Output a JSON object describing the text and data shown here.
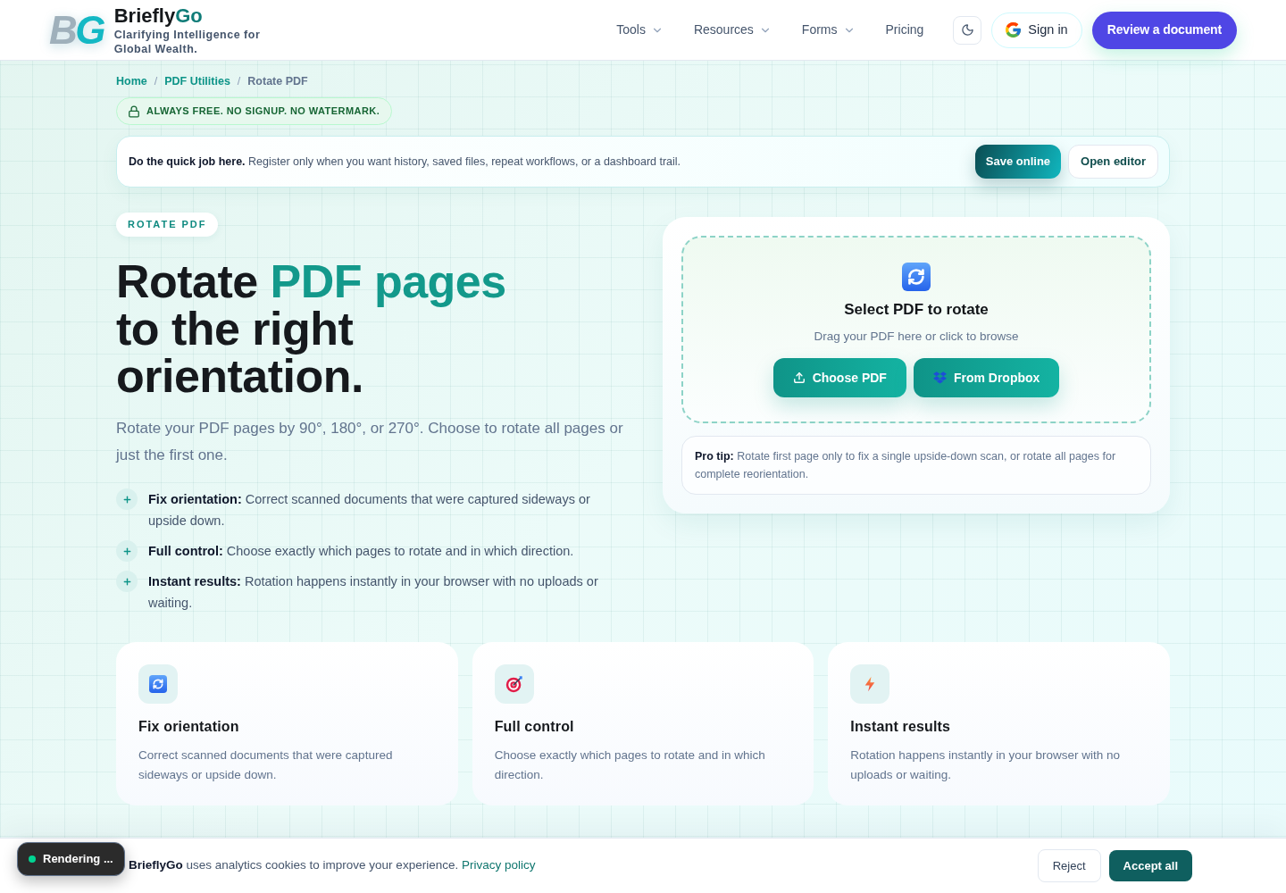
{
  "header": {
    "logo": {
      "mark": "BG",
      "name": "Briefly",
      "name_accent": "Go",
      "tagline": "Clarifying Intelligence for Global Wealth."
    },
    "nav": [
      {
        "label": "Tools",
        "dropdown": true
      },
      {
        "label": "Resources",
        "dropdown": true
      },
      {
        "label": "Forms",
        "dropdown": true
      },
      {
        "label": "Pricing",
        "dropdown": false
      }
    ],
    "sign_in": "Sign in",
    "cta": "Review a document"
  },
  "breadcrumb": [
    {
      "label": "Home",
      "current": false
    },
    {
      "label": "PDF Utilities",
      "current": false,
      "separator": "/"
    },
    {
      "label": "Rotate PDF",
      "current": true,
      "separator": "/"
    }
  ],
  "notice_badge": "ALWAYS FREE. NO SIGNUP. NO WATERMARK.",
  "quick_bar": {
    "text": "**Do the quick job here.** Register only when you want history, saved files, repeat workflows, or a dashboard trail.",
    "buttons": [
      {
        "label": "Save online",
        "kind": "primary"
      },
      {
        "label": "Open editor",
        "kind": "secondary"
      }
    ]
  },
  "hero": {
    "tag": "ROTATE PDF",
    "title": {
      "before": "Rotate",
      "accent": "PDF pages",
      "after": "to the right orientation."
    },
    "intro": "Rotate your PDF pages by 90°, 180°, or 270°. Choose to rotate all pages or just the first one.",
    "points": [
      "**Fix orientation:** Correct scanned documents that were captured sideways or upside down.",
      "**Full control:** Choose exactly which pages to rotate and in which direction.",
      "**Instant results:** Rotation happens instantly in your browser with no uploads or waiting."
    ]
  },
  "upload": {
    "title": "Select PDF to rotate",
    "hint": "Drag your PDF here or click to browse",
    "buttons": [
      {
        "label": "Choose PDF",
        "kind": "upload"
      },
      {
        "label": "From Dropbox",
        "kind": "dropbox"
      }
    ],
    "tip": "**Pro tip:** Rotate first page only to fix a single upside-down scan, or rotate all pages for complete reorientation."
  },
  "features": [
    {
      "kind": "rotate",
      "title": "Fix orientation",
      "text": "Correct scanned documents that were captured sideways or upside down."
    },
    {
      "kind": "target",
      "title": "Full control",
      "text": "Choose exactly which pages to rotate and in which direction."
    },
    {
      "kind": "bolt",
      "title": "Instant results",
      "text": "Rotation happens instantly in your browser with no uploads or waiting."
    }
  ],
  "status_toast": "Rendering ...",
  "cookie_bar": {
    "text": "**BrieflyGo** uses analytics cookies to improve your experience.",
    "link": "Privacy policy",
    "buttons": [
      {
        "label": "Reject",
        "kind": "secondary"
      },
      {
        "label": "Accept all",
        "kind": "primary"
      }
    ]
  }
}
